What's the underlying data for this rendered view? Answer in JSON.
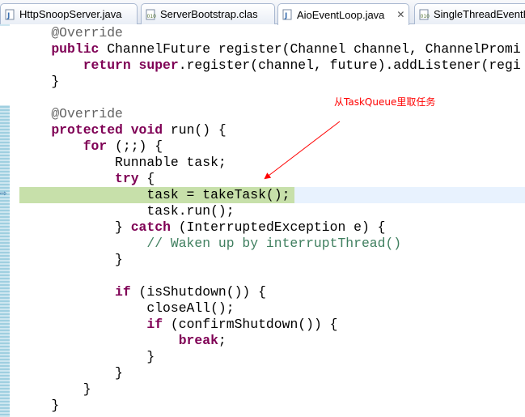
{
  "tabs": [
    {
      "label": "HttpSnoopServer.java",
      "icon": "java-file-icon",
      "active": false
    },
    {
      "label": "ServerBootstrap.clas",
      "icon": "class-file-icon",
      "active": false
    },
    {
      "label": "AioEventLoop.java",
      "icon": "java-file-icon",
      "active": true,
      "close": "✕"
    },
    {
      "label": "SingleThreadEventE",
      "icon": "class-file-icon",
      "active": false
    }
  ],
  "annotation": {
    "text": "从TaskQueue里取任务",
    "color": "#ff0000"
  },
  "code": {
    "lines": [
      [
        [
          "ann",
          "    @Override"
        ]
      ],
      [
        [
          "kw",
          "    public"
        ],
        [
          "",
          " ChannelFuture register(Channel channel, ChannelPromi"
        ]
      ],
      [
        [
          "kw",
          "        return super"
        ],
        [
          "",
          ".register(channel, future).addListener(regi"
        ]
      ],
      [
        [
          "",
          "    }"
        ]
      ],
      [
        [
          "",
          ""
        ]
      ],
      [
        [
          "ann",
          "    @Override"
        ]
      ],
      [
        [
          "kw",
          "    protected void"
        ],
        [
          "",
          " run() {"
        ]
      ],
      [
        [
          "kw",
          "        for"
        ],
        [
          "",
          " (;;) {"
        ]
      ],
      [
        [
          "",
          "            Runnable task;"
        ]
      ],
      [
        [
          "kw",
          "            try"
        ],
        [
          "",
          " {"
        ]
      ],
      [
        [
          "",
          "                task = takeTask();"
        ]
      ],
      [
        [
          "",
          "                task.run();"
        ]
      ],
      [
        [
          "",
          "            } "
        ],
        [
          "kw",
          "catch"
        ],
        [
          "",
          " (InterruptedException e) {"
        ]
      ],
      [
        [
          "cmt",
          "                // Waken up by interruptThread()"
        ]
      ],
      [
        [
          "",
          "            }"
        ]
      ],
      [
        [
          "",
          ""
        ]
      ],
      [
        [
          "kw",
          "            if"
        ],
        [
          "",
          " (isShutdown()) {"
        ]
      ],
      [
        [
          "",
          "                closeAll();"
        ]
      ],
      [
        [
          "kw",
          "                if"
        ],
        [
          "",
          " (confirmShutdown()) {"
        ]
      ],
      [
        [
          "kw",
          "                    break"
        ],
        [
          "",
          ";"
        ]
      ],
      [
        [
          "",
          "                }"
        ]
      ],
      [
        [
          "",
          "            }"
        ]
      ],
      [
        [
          "",
          "        }"
        ]
      ],
      [
        [
          "",
          "    }"
        ]
      ]
    ],
    "current_line_index": 10
  },
  "colors": {
    "keyword": "#7f0055",
    "annotation": "#646464",
    "comment": "#3f7f5f",
    "current_line": "#e8f2fe",
    "debug_highlight": "#c7e0aa"
  }
}
